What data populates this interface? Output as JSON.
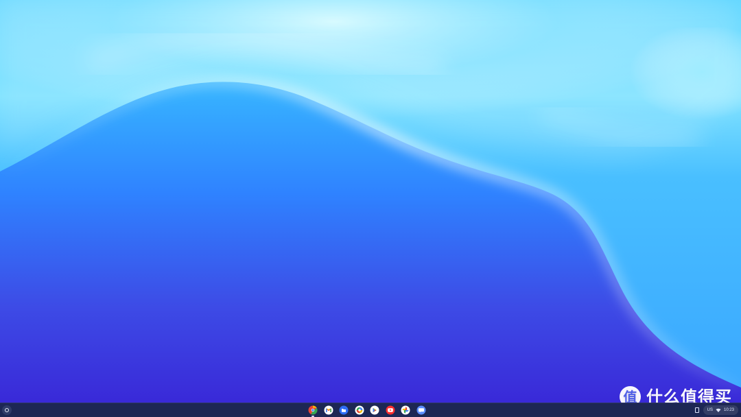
{
  "desktop": {
    "wallpaper_icon": "abstract-wave-wallpaper"
  },
  "shelf": {
    "launcher_icon": "launcher-circle-icon",
    "apps": [
      {
        "name": "chrome",
        "icon": "chrome-icon"
      },
      {
        "name": "gmail",
        "icon": "gmail-icon"
      },
      {
        "name": "files",
        "icon": "files-icon"
      },
      {
        "name": "camera",
        "icon": "camera-icon"
      },
      {
        "name": "play-store",
        "icon": "play-store-icon"
      },
      {
        "name": "youtube",
        "icon": "youtube-icon"
      },
      {
        "name": "photos",
        "icon": "photos-icon"
      },
      {
        "name": "messages",
        "icon": "messages-icon"
      }
    ],
    "status": {
      "keyboard": "US",
      "time": "10:23"
    }
  },
  "watermark": {
    "glyph": "值",
    "text": "什么值得买"
  },
  "colors": {
    "wallpaper_top": "#4ec8ff",
    "wallpaper_middle": "#2f7cff",
    "wallpaper_bottom": "#3a2fd8",
    "shelf": "#1d2754"
  }
}
